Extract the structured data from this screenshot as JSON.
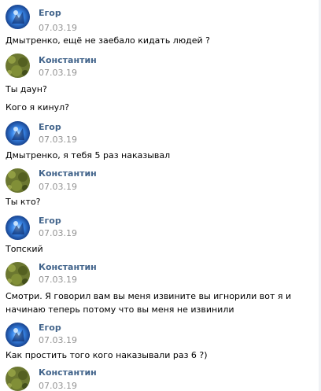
{
  "messages": [
    {
      "author": "Егор",
      "avatar": "egor-avatar-icon",
      "date": "07.03.19",
      "lines": [
        "Дмытренко, ещё не заебало кидать людей ?"
      ]
    },
    {
      "author": "Константин",
      "avatar": "konstantin-avatar-icon",
      "date": "07.03.19",
      "lines": [
        "Ты даун?",
        "Кого я кинул?"
      ]
    },
    {
      "author": "Егор",
      "avatar": "egor-avatar-icon",
      "date": "07.03.19",
      "lines": [
        "Дмытренко, я тебя 5 раз наказывал"
      ]
    },
    {
      "author": "Константин",
      "avatar": "konstantin-avatar-icon",
      "date": "07.03.19",
      "lines": [
        "Ты кто?"
      ]
    },
    {
      "author": "Егор",
      "avatar": "egor-avatar-icon",
      "date": "07.03.19",
      "lines": [
        "Топский"
      ]
    },
    {
      "author": "Константин",
      "avatar": "konstantin-avatar-icon",
      "date": "07.03.19",
      "lines": [
        "Смотри. Я говорил вам вы меня извините вы игнорили вот я и начинаю теперь потому что вы меня не извинили"
      ]
    },
    {
      "author": "Егор",
      "avatar": "egor-avatar-icon",
      "date": "07.03.19",
      "lines": [
        "Как простить того кого наказывали раз 6 ?)"
      ]
    },
    {
      "author": "Константин",
      "avatar": "konstantin-avatar-icon",
      "date": "07.03.19",
      "lines": []
    }
  ],
  "colors": {
    "author_name": "#42648b",
    "date": "#939393",
    "text": "#000000",
    "egor_avatar": "#1f6fd8",
    "konstantin_avatar": "#6e7a2c"
  }
}
